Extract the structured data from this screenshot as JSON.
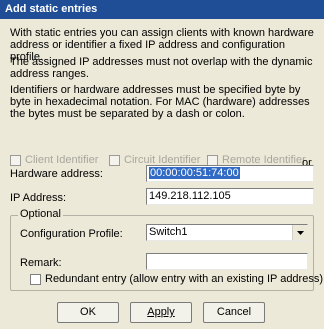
{
  "window": {
    "title": "Add static entries"
  },
  "description": {
    "p1": "With static entries you can assign clients with known hardware address or identifier a fixed IP address and configuration profile.",
    "p2": "The assigned IP addresses must not overlap with the dynamic address ranges.",
    "p3": "Identifiers or hardware addresses must be specified byte by byte in hexadecimal notation. For MAC (hardware) addresses the bytes must be separated by a dash or colon."
  },
  "options": {
    "client_identifier": "Client Identifier",
    "circuit_identifier": "Circuit Identifier",
    "remote_identifier": "Remote Identifier",
    "or_label": "or"
  },
  "hardware_address": {
    "label": "Hardware address:",
    "value": "00:00:00:51:74:00"
  },
  "ip_address": {
    "label": "IP Address:",
    "value": "149.218.112.105"
  },
  "optional": {
    "title": "Optional",
    "profile_label": "Configuration Profile:",
    "profile_value": "Switch1",
    "remark_label": "Remark:",
    "remark_value": "",
    "redundant_label": "Redundant entry (allow entry with an existing IP address)"
  },
  "buttons": {
    "ok": "OK",
    "apply": "Apply",
    "cancel": "Cancel"
  }
}
